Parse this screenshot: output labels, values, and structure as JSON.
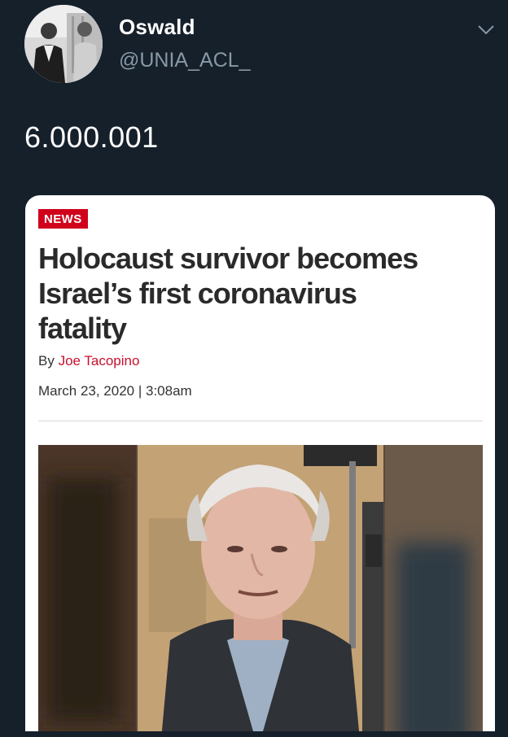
{
  "tweet": {
    "display_name": "Oswald",
    "handle": "@UNIA_ACL_",
    "text": "6.000.001"
  },
  "icons": {
    "menu": "chevron-down-icon",
    "avatar": "profile-photo"
  },
  "article_card": {
    "badge": "NEWS",
    "headline_line1": "Holocaust survivor becomes",
    "headline_line2": "Israel’s first coronavirus",
    "headline_line3": "fatality",
    "byline_prefix": "By ",
    "author": "Joe Tacopino",
    "date": "March 23, 2020 | 3:08am"
  },
  "colors": {
    "background": "#15202b",
    "badge": "#d0021b",
    "author_link": "#c8102e",
    "handle": "#8899a6"
  }
}
